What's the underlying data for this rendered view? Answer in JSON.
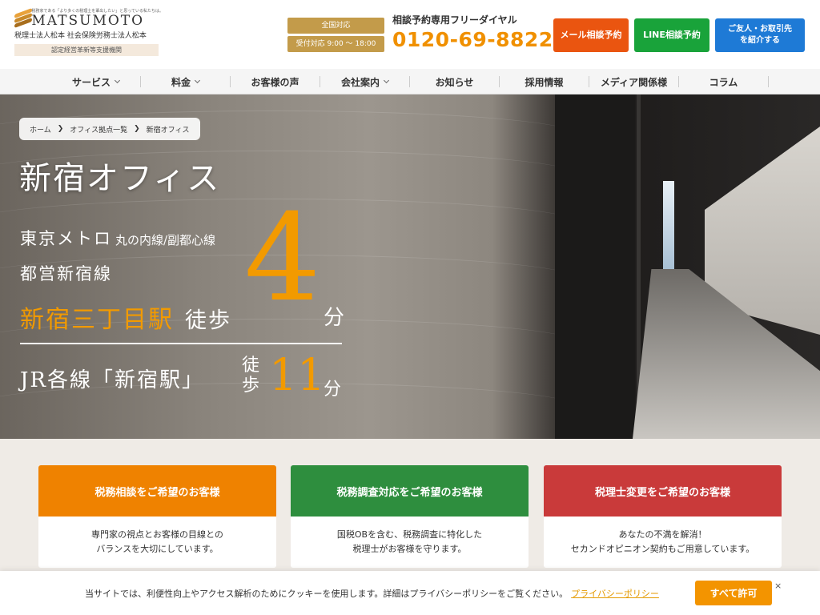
{
  "header": {
    "logo_tagline": "税務家である「より多くの税理士を輩出したい」と思っている私たちは。",
    "logo_name": "MATSUMOTO",
    "logo_sub": "税理士法人松本 社会保険労務士法人松本",
    "logo_badge": "認定経営革新等支援機関",
    "hours_nationwide": "全国対応",
    "hours_time": "受付対応 9:00 〜 18:00",
    "phone_label": "相談予約専用フリーダイヤル",
    "phone_number": "0120-69-8822",
    "btn_mail": "メール相談予約",
    "btn_line": "LINE相談予約",
    "btn_intro_1": "ご友人・お取引先",
    "btn_intro_2": "を紹介する"
  },
  "nav": {
    "items": [
      {
        "label": "サービス"
      },
      {
        "label": "料金"
      },
      {
        "label": "お客様の声"
      },
      {
        "label": "会社案内"
      },
      {
        "label": "お知らせ"
      },
      {
        "label": "採用情報"
      },
      {
        "label": "メディア関係様"
      },
      {
        "label": "コラム"
      }
    ]
  },
  "breadcrumb": {
    "home": "ホーム",
    "offices": "オフィス拠点一覧",
    "current": "新宿オフィス"
  },
  "hero": {
    "title": "新宿オフィス",
    "metro": "東京メトロ",
    "metro_lines": "丸の内線/副都心線",
    "toei": "都営新宿線",
    "station": "新宿三丁目駅",
    "walk": "徒歩",
    "minutes_near": "4",
    "unit": "分",
    "jr": "JR各線「新宿駅」",
    "walk_vertical": "徒歩",
    "minutes_jr": "11",
    "unit2": "分"
  },
  "cards": [
    {
      "title": "税務相談をご希望のお客様",
      "line1": "専門家の視点とお客様の目線との",
      "line2": "バランスを大切にしています。"
    },
    {
      "title": "税務調査対応をご希望のお客様",
      "line1": "国税OBを含む、税務調査に特化した",
      "line2": "税理士がお客様を守ります。"
    },
    {
      "title": "税理士変更をご希望のお客様",
      "line1": "あなたの不満を解消！",
      "line2": "セカンドオピニオン契約もご用意しています。"
    }
  ],
  "cookie": {
    "text": "当サイトでは、利便性向上やアクセス解析のためにクッキーを使用します。詳細はプライバシーポリシーをご覧ください。",
    "link": "プライバシーポリシー",
    "accept": "すべて許可",
    "close": "×"
  },
  "colors": {
    "accent_orange": "#f09000",
    "mail_button": "#ea5510",
    "line_button": "#19a33a",
    "intro_button": "#1e7ad6",
    "card_consult": "#ef8200",
    "card_audit": "#2e8e3e",
    "card_change": "#c93a3a"
  }
}
